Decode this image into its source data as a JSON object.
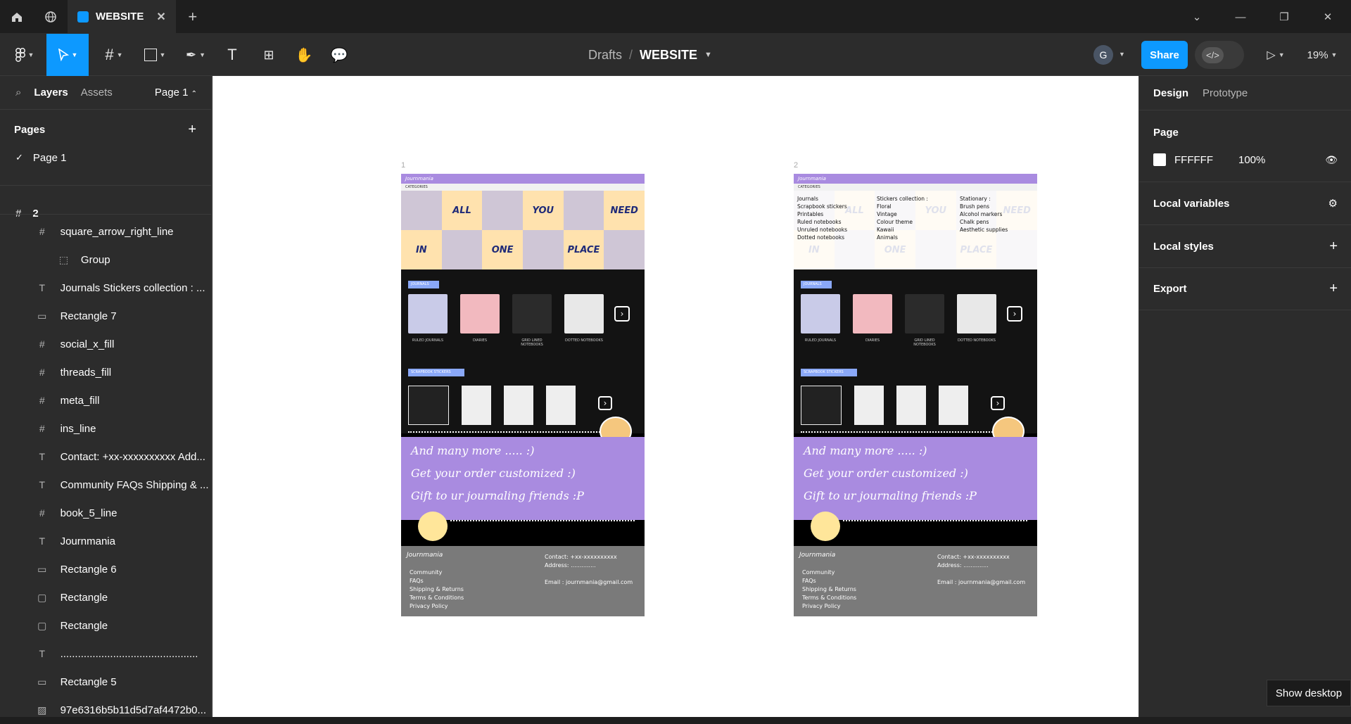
{
  "titlebar": {
    "tab_title": "WEBSITE"
  },
  "toolbar": {
    "breadcrumb_parent": "Drafts",
    "breadcrumb_sep": "/",
    "file_name": "WEBSITE",
    "avatar_initial": "G",
    "share_label": "Share",
    "zoom": "19%"
  },
  "left_panel": {
    "tab_layers": "Layers",
    "tab_assets": "Assets",
    "page_selector": "Page 1",
    "pages_heading": "Pages",
    "pages": [
      {
        "label": "Page 1"
      }
    ],
    "frame_name": "2",
    "layers": [
      {
        "icon": "#",
        "label": "square_arrow_right_line"
      },
      {
        "icon": "group",
        "label": "Group"
      },
      {
        "icon": "T",
        "label": "Journals Stickers collection : ..."
      },
      {
        "icon": "rect",
        "label": "Rectangle 7"
      },
      {
        "icon": "#",
        "label": "social_x_fill"
      },
      {
        "icon": "#",
        "label": "threads_fill"
      },
      {
        "icon": "#",
        "label": "meta_fill"
      },
      {
        "icon": "#",
        "label": "ins_line"
      },
      {
        "icon": "T",
        "label": "Contact: +xx-xxxxxxxxxx Add..."
      },
      {
        "icon": "T",
        "label": "Community FAQs Shipping & ..."
      },
      {
        "icon": "#",
        "label": "book_5_line"
      },
      {
        "icon": "T",
        "label": "Journmania"
      },
      {
        "icon": "rect",
        "label": "Rectangle 6"
      },
      {
        "icon": "play",
        "label": "Rectangle"
      },
      {
        "icon": "play",
        "label": "Rectangle"
      },
      {
        "icon": "T",
        "label": "..............................................."
      },
      {
        "icon": "rect",
        "label": "Rectangle 5"
      },
      {
        "icon": "img",
        "label": "97e6316b5b11d5d7af4472b0..."
      }
    ]
  },
  "right_panel": {
    "tab_design": "Design",
    "tab_prototype": "Prototype",
    "page_heading": "Page",
    "page_color": "FFFFFF",
    "page_opacity": "100%",
    "local_variables": "Local variables",
    "local_styles": "Local styles",
    "export": "Export"
  },
  "canvas": {
    "frame1_label": "1",
    "frame2_label": "2",
    "site": {
      "logo": "Journmania",
      "categories": "CATEGORIES",
      "hero_words": [
        "ALL",
        "YOU",
        "NEED",
        "IN",
        "ONE",
        "PLACE"
      ],
      "journals_badge": "JOURNALS",
      "journal_cards": [
        "RULED JOURNALS",
        "DIARIES",
        "GRID LINED NOTEBOOKS",
        "DOTTED NOTEBOOKS"
      ],
      "stickers_badge": "SCRAPBOOK STICKERS",
      "promo_lines": [
        "And many more ..... :)",
        "Get your order customized :)",
        "Gift to ur journaling friends :P"
      ],
      "footer_links": [
        "Community",
        "FAQs",
        "Shipping & Returns",
        "Terms & Conditions",
        "Privacy Policy"
      ],
      "footer_contact": "Contact: +xx-xxxxxxxxxx",
      "footer_address": "Address: ..............",
      "footer_email": "Email : journmania@gmail.com"
    },
    "dropdown": {
      "col1": [
        "Journals",
        "Scrapbook stickers",
        "Printables",
        "Ruled notebooks",
        "Unruled notebooks",
        "Dotted notebooks"
      ],
      "col2": [
        "Stickers collection :",
        "Floral",
        "Vintage",
        "Colour theme",
        "Kawaii",
        "Animals"
      ],
      "col3": [
        "Stationary :",
        "Brush pens",
        "Alcohol markers",
        "Chalk pens",
        "Aesthetic supplies"
      ]
    }
  },
  "taskbar": {
    "show_desktop": "Show desktop"
  }
}
